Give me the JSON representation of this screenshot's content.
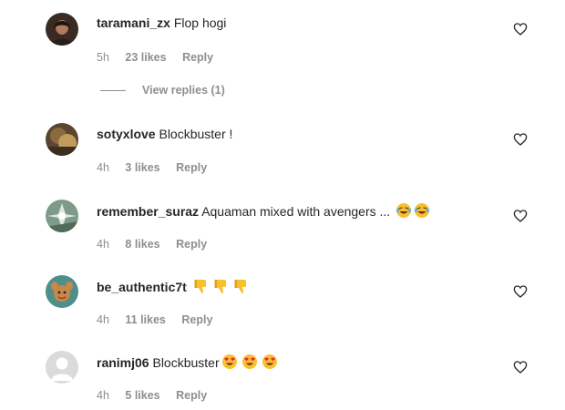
{
  "comments": [
    {
      "username": "taramani_zx",
      "text": "Flop hogi",
      "time": "5h",
      "likes": "23 likes",
      "reply": "Reply",
      "avatar": "user-photo-avatar",
      "view_replies": "View replies (1)"
    },
    {
      "username": "sotyxlove",
      "text": "Blockbuster !",
      "time": "4h",
      "likes": "3 likes",
      "reply": "Reply",
      "avatar": "user-photo-avatar"
    },
    {
      "username": "remember_suraz",
      "text": "Aquaman mixed with avengers ...",
      "time": "4h",
      "likes": "8 likes",
      "reply": "Reply",
      "avatar": "user-photo-avatar",
      "emojis": [
        "laughing-tears-emoji",
        "laughing-tears-emoji"
      ]
    },
    {
      "username": "be_authentic7t",
      "text": "",
      "time": "4h",
      "likes": "11 likes",
      "reply": "Reply",
      "avatar": "cartoon-avatar",
      "emojis": [
        "thumbs-down-emoji",
        "thumbs-down-emoji",
        "thumbs-down-emoji"
      ]
    },
    {
      "username": "ranimj06",
      "text": "Blockbuster",
      "time": "4h",
      "likes": "5 likes",
      "reply": "Reply",
      "avatar": "default-avatar",
      "emojis": [
        "heart-eyes-emoji",
        "heart-eyes-emoji",
        "heart-eyes-emoji"
      ]
    }
  ],
  "icons": {
    "like": "heart-outline-icon"
  },
  "colors": {
    "text": "#262626",
    "secondary": "#8e8e8e",
    "emoji_yellow": "#f7c02d"
  }
}
